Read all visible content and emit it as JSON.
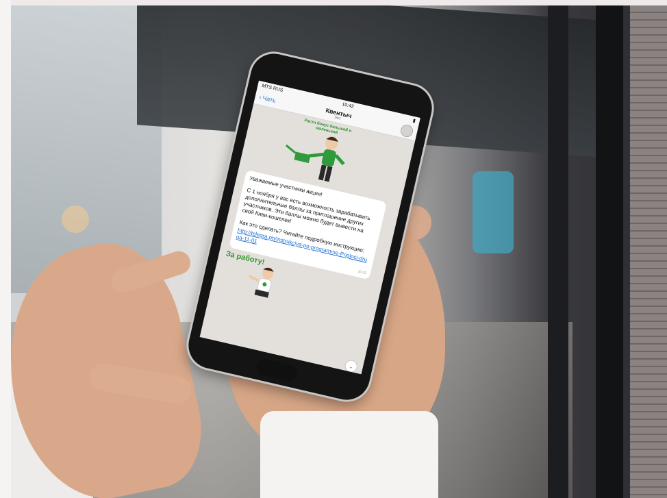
{
  "colors": {
    "green_accent": "#2d9a2d",
    "link_blue": "#1d6fcf",
    "ios_blue": "#2a7bd9"
  },
  "phone": {
    "status_bar": {
      "carrier": "MTS RUS",
      "time": "10:42",
      "battery_label": "▮"
    },
    "nav": {
      "back_label": "Чать",
      "title": "Квентыч",
      "subtitle": "бот"
    },
    "sticker_top": {
      "caption": "Расти бонус большой и маленький"
    },
    "message": {
      "greeting": "Уважаемые участники акции!",
      "body": "С 1 ноября у вас есть возможность зарабатывать дополнительные баллы за приглашение других участников. Эти баллы можно будет вывести на свой Киви-кошелек!",
      "how_to": "Как это сделать? Читайте подробную инструкцию:",
      "link": "http://telegra.ph/instrukciya-po-programme-Prigloci-druga-11-01",
      "time": "10:42"
    },
    "sticker_bottom": {
      "label": "За работу!"
    },
    "scroll_down_icon": "chevron-down-icon"
  }
}
